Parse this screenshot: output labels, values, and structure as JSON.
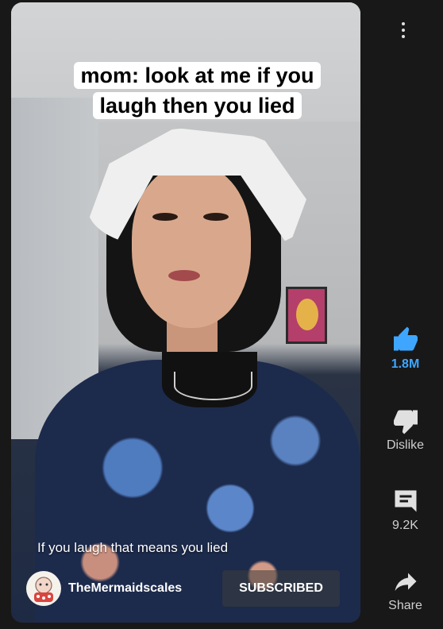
{
  "video": {
    "caption_line1": "mom: look at me if you",
    "caption_line2": "laugh then you lied",
    "subtitle": "If you laugh that means you lied"
  },
  "channel": {
    "name": "TheMermaidscales",
    "subscribe_label": "SUBSCRIBED"
  },
  "actions": {
    "like_count": "1.8M",
    "dislike_label": "Dislike",
    "comment_count": "9.2K",
    "share_label": "Share"
  },
  "colors": {
    "like_accent": "#3ea6ff",
    "icon": "#e0e0e0",
    "background": "#181818"
  }
}
